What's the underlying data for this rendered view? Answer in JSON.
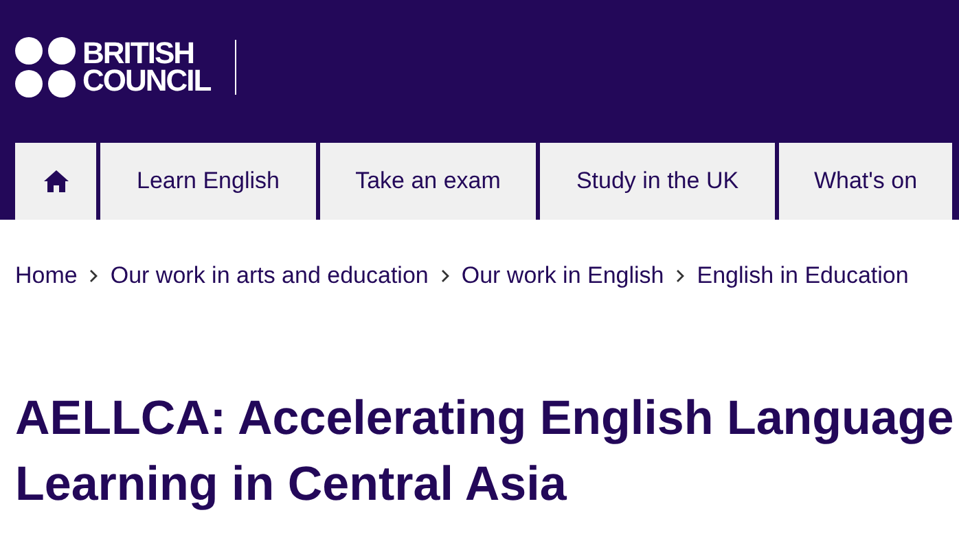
{
  "logo": {
    "lines": [
      "BRITISH",
      "COUNCIL"
    ]
  },
  "nav": [
    {
      "kind": "home"
    },
    {
      "kind": "link",
      "label": "Learn English"
    },
    {
      "kind": "link",
      "label": "Take an exam"
    },
    {
      "kind": "link",
      "label": "Study in the UK"
    },
    {
      "kind": "link",
      "label": "What's on"
    }
  ],
  "breadcrumbs": [
    "Home",
    "Our work in arts and education",
    "Our work in English",
    "English in Education"
  ],
  "heading": "AELLCA: Accelerating English Language Learning in Central Asia"
}
